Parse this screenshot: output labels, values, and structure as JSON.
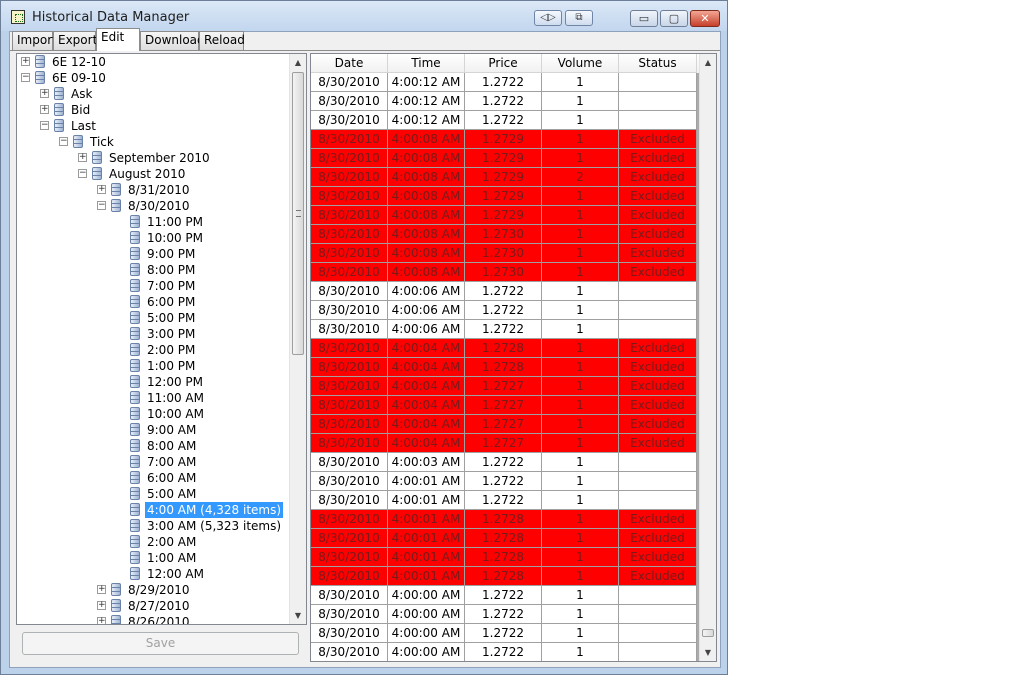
{
  "window": {
    "title": "Historical Data Manager",
    "minimize_label": "▭",
    "maximize_label": "▢",
    "close_label": "✕",
    "title_tool_1": "◁▷",
    "title_tool_2": "⧉"
  },
  "tabs": [
    {
      "label": "Import"
    },
    {
      "label": "Export"
    },
    {
      "label": "Edit",
      "active": true
    },
    {
      "label": "Download"
    },
    {
      "label": "Reload"
    }
  ],
  "tree": [
    {
      "label": "6E 12-10",
      "level": 0,
      "expander": "+"
    },
    {
      "label": "6E 09-10",
      "level": 0,
      "expander": "−"
    },
    {
      "label": "Ask",
      "level": 1,
      "expander": "+"
    },
    {
      "label": "Bid",
      "level": 1,
      "expander": "+"
    },
    {
      "label": "Last",
      "level": 1,
      "expander": "−"
    },
    {
      "label": "Tick",
      "level": 2,
      "expander": "−"
    },
    {
      "label": "September 2010",
      "level": 3,
      "expander": "+"
    },
    {
      "label": "August 2010",
      "level": 3,
      "expander": "−"
    },
    {
      "label": "8/31/2010",
      "level": 4,
      "expander": "+"
    },
    {
      "label": "8/30/2010",
      "level": 4,
      "expander": "−"
    },
    {
      "label": "11:00 PM",
      "level": 5
    },
    {
      "label": "10:00 PM",
      "level": 5
    },
    {
      "label": "9:00 PM",
      "level": 5
    },
    {
      "label": "8:00 PM",
      "level": 5
    },
    {
      "label": "7:00 PM",
      "level": 5
    },
    {
      "label": "6:00 PM",
      "level": 5
    },
    {
      "label": "5:00 PM",
      "level": 5
    },
    {
      "label": "3:00 PM",
      "level": 5
    },
    {
      "label": "2:00 PM",
      "level": 5
    },
    {
      "label": "1:00 PM",
      "level": 5
    },
    {
      "label": "12:00 PM",
      "level": 5
    },
    {
      "label": "11:00 AM",
      "level": 5
    },
    {
      "label": "10:00 AM",
      "level": 5
    },
    {
      "label": "9:00 AM",
      "level": 5
    },
    {
      "label": "8:00 AM",
      "level": 5
    },
    {
      "label": "7:00 AM",
      "level": 5
    },
    {
      "label": "6:00 AM",
      "level": 5
    },
    {
      "label": "5:00 AM",
      "level": 5
    },
    {
      "label": "4:00 AM (4,328 items)",
      "level": 5,
      "selected": true
    },
    {
      "label": "3:00 AM (5,323 items)",
      "level": 5
    },
    {
      "label": "2:00 AM",
      "level": 5
    },
    {
      "label": "1:00 AM",
      "level": 5
    },
    {
      "label": "12:00 AM",
      "level": 5
    },
    {
      "label": "8/29/2010",
      "level": 4,
      "expander": "+"
    },
    {
      "label": "8/27/2010",
      "level": 4,
      "expander": "+"
    },
    {
      "label": "8/26/2010",
      "level": 4,
      "expander": "+"
    }
  ],
  "save_label": "Save",
  "grid": {
    "columns": [
      "Date",
      "Time",
      "Price",
      "Volume",
      "Status"
    ],
    "excluded_color": "#fe0000",
    "rows": [
      [
        "8/30/2010",
        "4:00:12 AM",
        "1.2722",
        "1",
        ""
      ],
      [
        "8/30/2010",
        "4:00:12 AM",
        "1.2722",
        "1",
        ""
      ],
      [
        "8/30/2010",
        "4:00:12 AM",
        "1.2722",
        "1",
        ""
      ],
      [
        "8/30/2010",
        "4:00:08 AM",
        "1.2729",
        "1",
        "Excluded"
      ],
      [
        "8/30/2010",
        "4:00:08 AM",
        "1.2729",
        "1",
        "Excluded"
      ],
      [
        "8/30/2010",
        "4:00:08 AM",
        "1.2729",
        "2",
        "Excluded"
      ],
      [
        "8/30/2010",
        "4:00:08 AM",
        "1.2729",
        "1",
        "Excluded"
      ],
      [
        "8/30/2010",
        "4:00:08 AM",
        "1.2729",
        "1",
        "Excluded"
      ],
      [
        "8/30/2010",
        "4:00:08 AM",
        "1.2730",
        "1",
        "Excluded"
      ],
      [
        "8/30/2010",
        "4:00:08 AM",
        "1.2730",
        "1",
        "Excluded"
      ],
      [
        "8/30/2010",
        "4:00:08 AM",
        "1.2730",
        "1",
        "Excluded"
      ],
      [
        "8/30/2010",
        "4:00:06 AM",
        "1.2722",
        "1",
        ""
      ],
      [
        "8/30/2010",
        "4:00:06 AM",
        "1.2722",
        "1",
        ""
      ],
      [
        "8/30/2010",
        "4:00:06 AM",
        "1.2722",
        "1",
        ""
      ],
      [
        "8/30/2010",
        "4:00:04 AM",
        "1.2728",
        "1",
        "Excluded"
      ],
      [
        "8/30/2010",
        "4:00:04 AM",
        "1.2728",
        "1",
        "Excluded"
      ],
      [
        "8/30/2010",
        "4:00:04 AM",
        "1.2727",
        "1",
        "Excluded"
      ],
      [
        "8/30/2010",
        "4:00:04 AM",
        "1.2727",
        "1",
        "Excluded"
      ],
      [
        "8/30/2010",
        "4:00:04 AM",
        "1.2727",
        "1",
        "Excluded"
      ],
      [
        "8/30/2010",
        "4:00:04 AM",
        "1.2727",
        "1",
        "Excluded"
      ],
      [
        "8/30/2010",
        "4:00:03 AM",
        "1.2722",
        "1",
        ""
      ],
      [
        "8/30/2010",
        "4:00:01 AM",
        "1.2722",
        "1",
        ""
      ],
      [
        "8/30/2010",
        "4:00:01 AM",
        "1.2722",
        "1",
        ""
      ],
      [
        "8/30/2010",
        "4:00:01 AM",
        "1.2728",
        "1",
        "Excluded"
      ],
      [
        "8/30/2010",
        "4:00:01 AM",
        "1.2728",
        "1",
        "Excluded"
      ],
      [
        "8/30/2010",
        "4:00:01 AM",
        "1.2728",
        "1",
        "Excluded"
      ],
      [
        "8/30/2010",
        "4:00:01 AM",
        "1.2728",
        "1",
        "Excluded"
      ],
      [
        "8/30/2010",
        "4:00:00 AM",
        "1.2722",
        "1",
        ""
      ],
      [
        "8/30/2010",
        "4:00:00 AM",
        "1.2722",
        "1",
        ""
      ],
      [
        "8/30/2010",
        "4:00:00 AM",
        "1.2722",
        "1",
        ""
      ],
      [
        "8/30/2010",
        "4:00:00 AM",
        "1.2722",
        "1",
        ""
      ]
    ]
  }
}
